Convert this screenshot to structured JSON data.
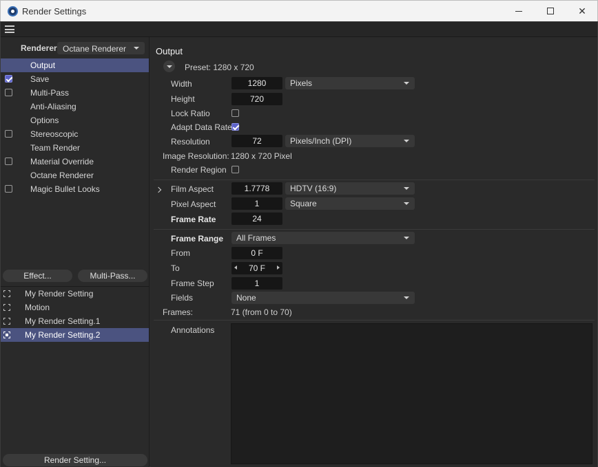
{
  "window": {
    "title": "Render Settings"
  },
  "left": {
    "renderer_label": "Renderer",
    "renderer_value": "Octane Renderer",
    "nav": [
      {
        "label": "Output",
        "checkbox": null,
        "active": true
      },
      {
        "label": "Save",
        "checkbox": true,
        "active": false
      },
      {
        "label": "Multi-Pass",
        "checkbox": false,
        "active": false
      },
      {
        "label": "Anti-Aliasing",
        "checkbox": null,
        "active": false
      },
      {
        "label": "Options",
        "checkbox": null,
        "active": false
      },
      {
        "label": "Stereoscopic",
        "checkbox": false,
        "active": false
      },
      {
        "label": "Team Render",
        "checkbox": null,
        "active": false
      },
      {
        "label": "Material Override",
        "checkbox": false,
        "active": false
      },
      {
        "label": "Octane Renderer",
        "checkbox": null,
        "active": false
      },
      {
        "label": "Magic Bullet Looks",
        "checkbox": false,
        "active": false
      }
    ],
    "effect_button": "Effect...",
    "multipass_button": "Multi-Pass...",
    "settings": [
      {
        "label": "My Render Setting",
        "active": false
      },
      {
        "label": "Motion",
        "active": false
      },
      {
        "label": "My Render Setting.1",
        "active": false
      },
      {
        "label": "My Render Setting.2",
        "active": true
      }
    ],
    "render_setting_button": "Render Setting..."
  },
  "output": {
    "title": "Output",
    "preset": "Preset: 1280 x 720",
    "width_label": "Width",
    "width_value": "1280",
    "width_unit": "Pixels",
    "height_label": "Height",
    "height_value": "720",
    "lock_ratio_label": "Lock Ratio",
    "lock_ratio": false,
    "adapt_label": "Adapt Data Rate",
    "adapt": true,
    "resolution_label": "Resolution",
    "resolution_value": "72",
    "resolution_unit": "Pixels/Inch (DPI)",
    "image_res_label": "Image Resolution:",
    "image_res_value": "1280 x 720 Pixel",
    "render_region_label": "Render Region",
    "render_region": false,
    "film_aspect_label": "Film Aspect",
    "film_aspect_value": "1.7778",
    "film_aspect_preset": "HDTV (16:9)",
    "pixel_aspect_label": "Pixel Aspect",
    "pixel_aspect_value": "1",
    "pixel_aspect_preset": "Square",
    "frame_rate_label": "Frame Rate",
    "frame_rate_value": "24",
    "frame_range_label": "Frame Range",
    "frame_range_value": "All Frames",
    "from_label": "From",
    "from_value": "0 F",
    "to_label": "To",
    "to_value": "70 F",
    "frame_step_label": "Frame Step",
    "frame_step_value": "1",
    "fields_label": "Fields",
    "fields_value": "None",
    "frames_label": "Frames:",
    "frames_value": "71 (from 0 to 70)",
    "annotations_label": "Annotations"
  }
}
